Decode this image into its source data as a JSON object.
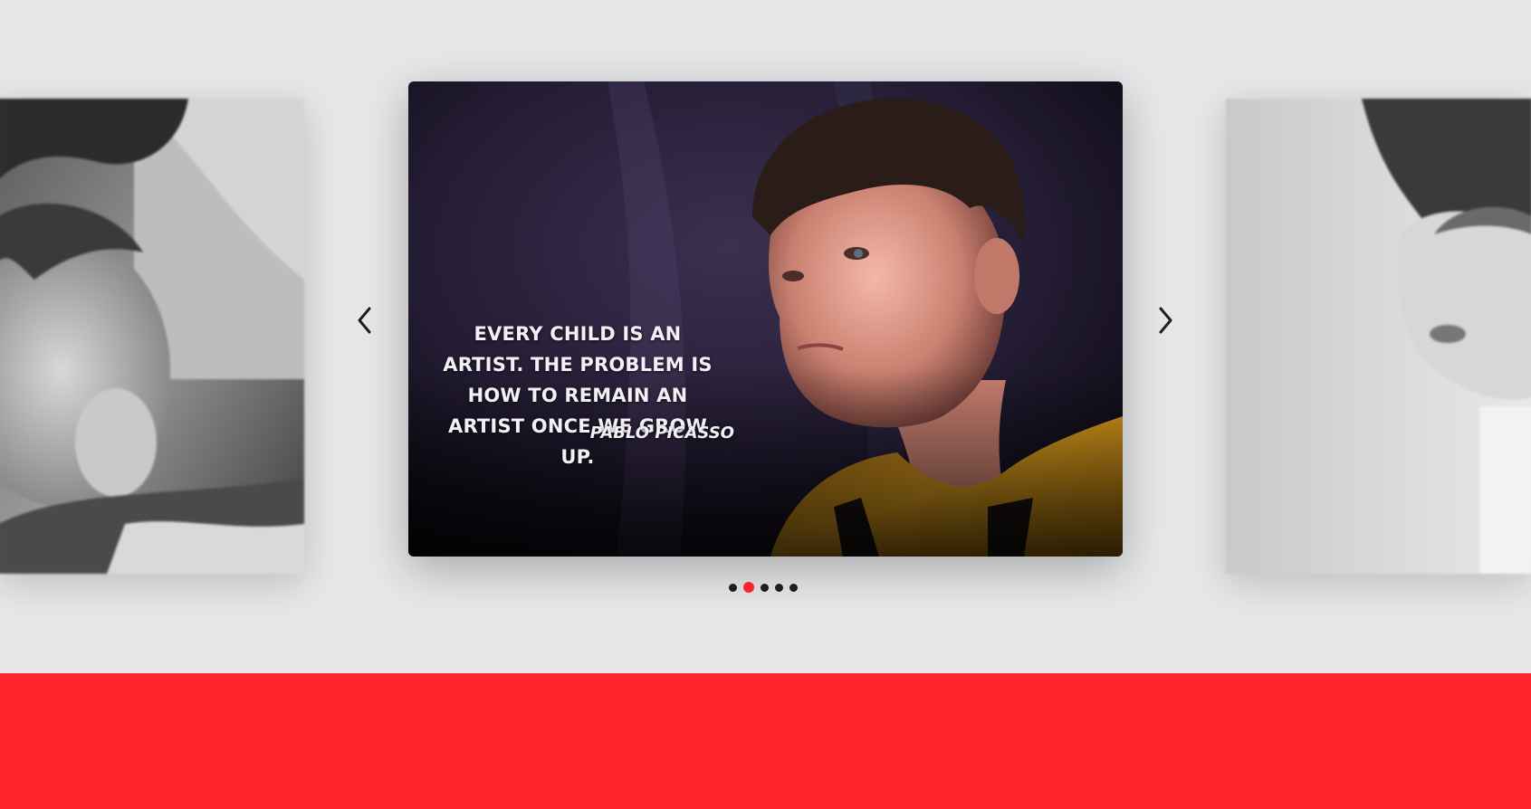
{
  "carousel": {
    "quote": "EVERY CHILD IS AN ARTIST. THE PROBLEM IS HOW TO REMAIN AN ARTIST ONCE WE GROW UP.",
    "author": "PABLO PICASSO",
    "prev_icon": "chevron-left-icon",
    "next_icon": "chevron-right-icon",
    "slide_count": 5,
    "active_index": 1,
    "dots": [
      "1",
      "2",
      "3",
      "4",
      "5"
    ]
  },
  "colors": {
    "accent": "#ff242c",
    "background": "#e6e7e9",
    "dot": "#1e1e22",
    "text": "#f3f0f6"
  }
}
